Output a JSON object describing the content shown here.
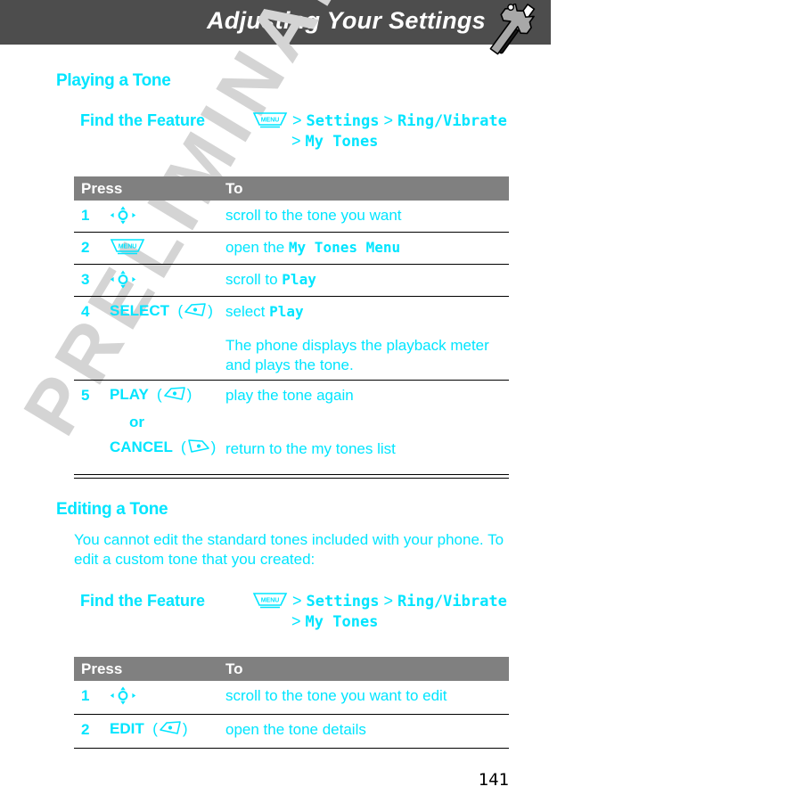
{
  "header": {
    "title": "Adjusting Your Settings",
    "icon": "wrench-screwdriver-icon",
    "bar_color": "#4d4d4d",
    "text_color": "#ffffff"
  },
  "watermark": {
    "text": "PRELIMINARY",
    "color": "#d4d4d4"
  },
  "theme": {
    "accent": "#00e5ff",
    "table_header_bg": "#808080",
    "rule_color": "#000000",
    "page_bg": "#ffffff"
  },
  "sections": [
    {
      "title": "Playing a Tone",
      "find_the_feature": {
        "label": "Find the Feature",
        "key_icon": "menu-key-icon",
        "key_label": "MENU",
        "path_line1": [
          {
            "type": "sep",
            "text": ">"
          },
          {
            "type": "mono",
            "text": "Settings"
          },
          {
            "type": "sep",
            "text": ">"
          },
          {
            "type": "mono",
            "text": "Ring/Vibrate"
          }
        ],
        "path_line2": [
          {
            "type": "sep",
            "text": ">"
          },
          {
            "type": "mono",
            "text": "My Tones"
          }
        ]
      },
      "table": {
        "columns": [
          "Press",
          "To"
        ],
        "rows": [
          {
            "num": "1",
            "press_icon": "nav-key-icon",
            "press_text": "",
            "to_parts": [
              {
                "type": "plain",
                "text": "scroll to the tone you want"
              }
            ]
          },
          {
            "num": "2",
            "press_icon": "menu-key-icon",
            "press_text": "",
            "to_parts": [
              {
                "type": "plain",
                "text": "open the "
              },
              {
                "type": "mono",
                "text": "My Tones Menu"
              }
            ]
          },
          {
            "num": "3",
            "press_icon": "nav-key-icon",
            "press_text": "",
            "to_parts": [
              {
                "type": "plain",
                "text": "scroll to "
              },
              {
                "type": "mono",
                "text": "Play"
              }
            ]
          },
          {
            "num": "4",
            "press_icon": "left-softkey-icon",
            "press_text": "SELECT",
            "to_parts": [
              {
                "type": "plain",
                "text": "select "
              },
              {
                "type": "mono",
                "text": "Play"
              }
            ],
            "note": "The phone displays the playback meter and plays the tone."
          },
          {
            "num": "5",
            "press_icon": "left-softkey-icon",
            "press_text": "PLAY",
            "to_parts": [
              {
                "type": "plain",
                "text": "play the tone again"
              }
            ],
            "or_label": "or",
            "press_alt_icon": "right-softkey-icon",
            "press_alt_text": "CANCEL",
            "to_alt_parts": [
              {
                "type": "plain",
                "text": "return to the my tones list"
              }
            ]
          }
        ]
      }
    },
    {
      "title": "Editing a Tone",
      "paragraph": "You cannot edit the standard tones included with your phone. To edit a custom tone that you created:",
      "find_the_feature": {
        "label": "Find the Feature",
        "key_icon": "menu-key-icon",
        "key_label": "MENU",
        "path_line1": [
          {
            "type": "sep",
            "text": ">"
          },
          {
            "type": "mono",
            "text": "Settings"
          },
          {
            "type": "sep",
            "text": ">"
          },
          {
            "type": "mono",
            "text": "Ring/Vibrate"
          }
        ],
        "path_line2": [
          {
            "type": "sep",
            "text": ">"
          },
          {
            "type": "mono",
            "text": "My Tones"
          }
        ]
      },
      "table": {
        "columns": [
          "Press",
          "To"
        ],
        "rows": [
          {
            "num": "1",
            "press_icon": "nav-key-icon",
            "press_text": "",
            "to_parts": [
              {
                "type": "plain",
                "text": "scroll to the tone you want to edit"
              }
            ]
          },
          {
            "num": "2",
            "press_icon": "left-softkey-icon",
            "press_text": "EDIT",
            "to_parts": [
              {
                "type": "plain",
                "text": "open the tone details"
              }
            ]
          }
        ]
      }
    }
  ],
  "page_number": "141"
}
